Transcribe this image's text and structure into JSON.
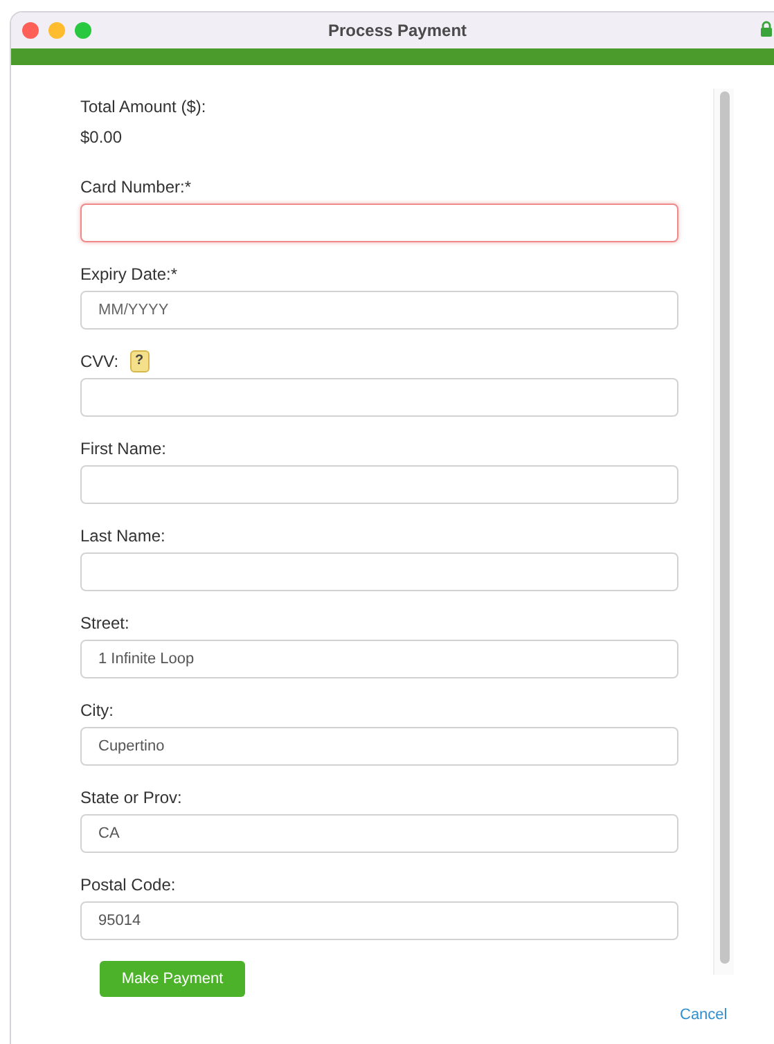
{
  "window": {
    "title": "Process Payment"
  },
  "total": {
    "label": "Total Amount ($):",
    "value": "$0.00"
  },
  "fields": [
    {
      "label": "Card Number:*",
      "invalid": true
    },
    {
      "label": "Expiry Date:*",
      "placeholder": "MM/YYYY",
      "invalid": false
    },
    {
      "label": "CVV:",
      "help": "?",
      "invalid": false
    },
    {
      "label": "First Name:",
      "invalid": false
    },
    {
      "label": "Last Name:",
      "invalid": false
    },
    {
      "label": "Street:",
      "value": "1 Infinite Loop",
      "invalid": false
    },
    {
      "label": "City:",
      "value": "Cupertino",
      "invalid": false
    },
    {
      "label": "State or Prov:",
      "value": "CA",
      "invalid": false
    },
    {
      "label": "Postal Code:",
      "value": "95014",
      "invalid": false
    }
  ],
  "submit": "Make Payment",
  "cancel": "Cancel"
}
